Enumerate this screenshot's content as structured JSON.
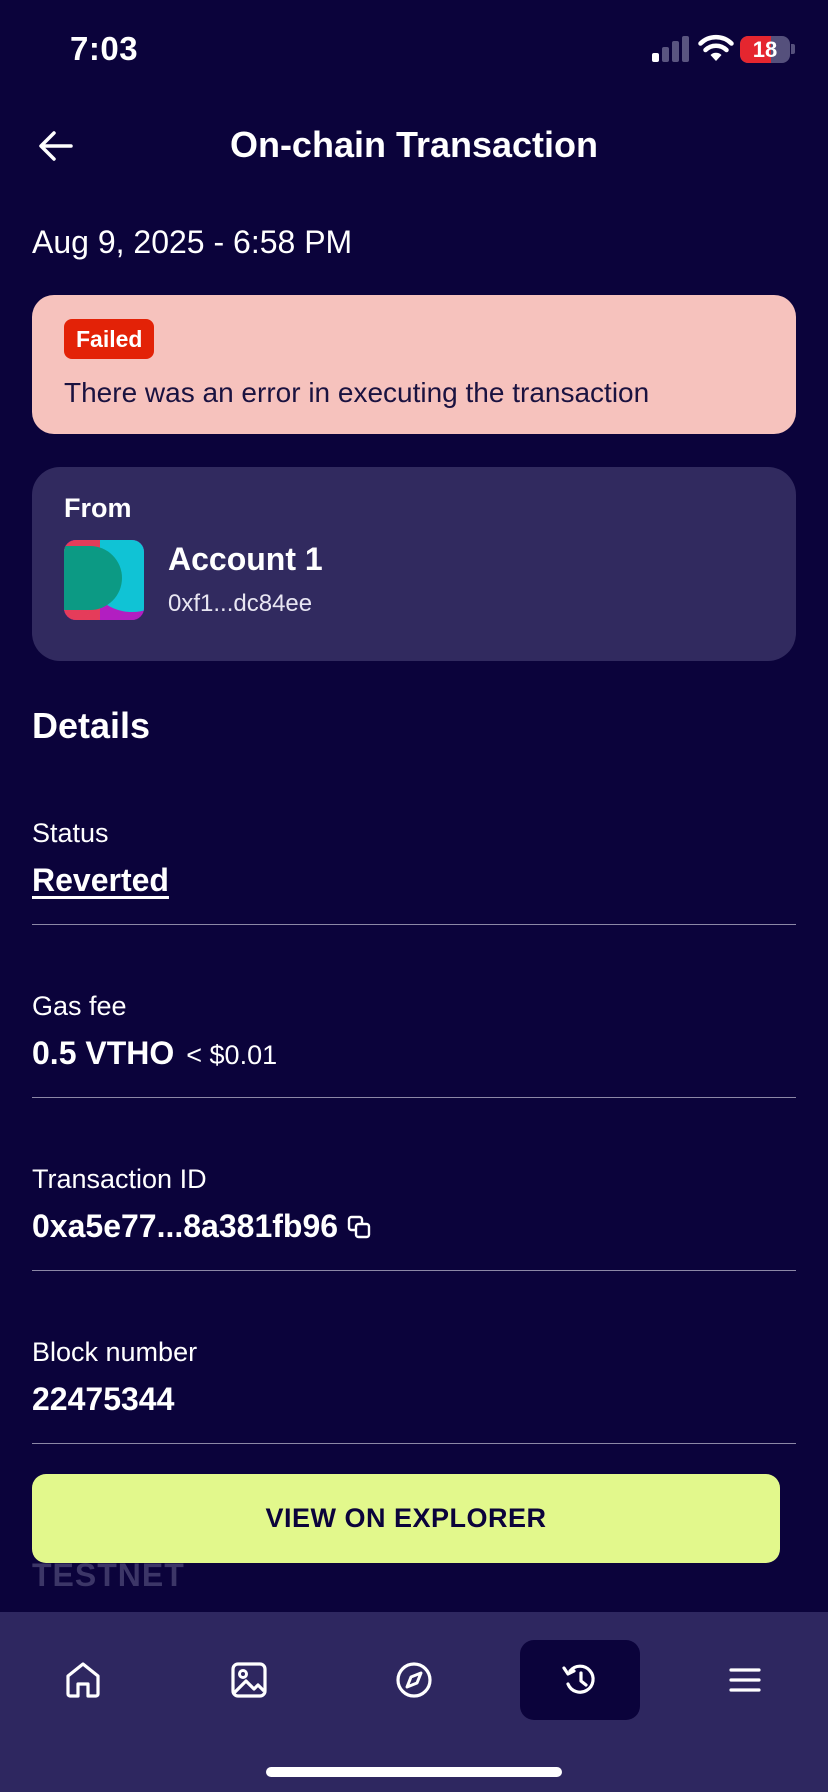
{
  "status_bar": {
    "time": "7:03",
    "battery_level": "18",
    "battery_fraction": 0.62,
    "signal_bars_active": 1
  },
  "header": {
    "title": "On-chain Transaction",
    "back_icon": "arrow-left-icon"
  },
  "transaction": {
    "date": "Aug 9, 2025 - 6:58 PM",
    "status_badge": "Failed",
    "error_message": "There was an error in executing the transaction"
  },
  "from": {
    "label": "From",
    "account_name": "Account 1",
    "address": "0xf1...dc84ee"
  },
  "details": {
    "title": "Details",
    "rows": {
      "status": {
        "label": "Status",
        "value": "Reverted"
      },
      "gas_fee": {
        "label": "Gas fee",
        "value": "0.5 VTHO",
        "usd": "< $0.01"
      },
      "tx_id": {
        "label": "Transaction ID",
        "value": "0xa5e77...8a381fb96"
      },
      "block": {
        "label": "Block number",
        "value": "22475344"
      }
    }
  },
  "actions": {
    "explorer_label": "VIEW ON EXPLORER"
  },
  "network_label": "TESTNET",
  "tabs": [
    {
      "name": "home",
      "icon": "home-icon",
      "active": false
    },
    {
      "name": "nfts",
      "icon": "image-icon",
      "active": false
    },
    {
      "name": "discover",
      "icon": "compass-icon",
      "active": false
    },
    {
      "name": "activity",
      "icon": "history-icon",
      "active": true
    },
    {
      "name": "menu",
      "icon": "menu-icon",
      "active": false
    }
  ],
  "colors": {
    "background": "#0b033b",
    "card": "#312a5f",
    "error_bg": "#f6c2bd",
    "badge": "#e32207",
    "accent_button": "#e2f88c",
    "tab_bar": "#2e2760"
  }
}
